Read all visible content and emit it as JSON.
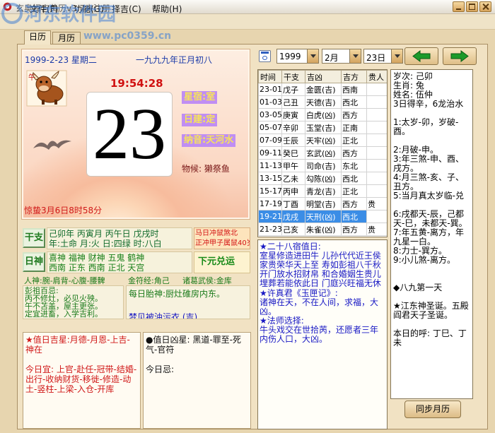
{
  "window": {
    "title": "玄奥择吉黄历v3.7未注册"
  },
  "watermark": {
    "site_name": "河东软件园",
    "url": "www.pc0359.cn"
  },
  "menu": [
    "文件(F)",
    "功能(G)",
    "择吉(C)",
    "帮助(H)"
  ],
  "tabs": [
    {
      "label": "日历",
      "selected": true
    },
    {
      "label": "月历",
      "selected": false
    }
  ],
  "day_view": {
    "date": "1999-2-23 星期二",
    "lunar_date": "一九九九年正月初八",
    "zodiac_label": "午",
    "time": "19:54:28",
    "day": "23",
    "xingxiu": "星宿:室",
    "rijian": "日建:定",
    "nayin": "纳音:天河水",
    "wuhou": "物候: 獭祭鱼",
    "solar_term": "惊蛰3月6日8时58分"
  },
  "ganzhi": {
    "button": "干支",
    "line1": "己卯年 丙寅月 丙午日 戊戌时",
    "line2": "年:土命 月:火 日:四绿 时:八白",
    "chong1": "马日冲鼠煞北",
    "chong2": "正冲甲子属鼠40岁"
  },
  "rishen": {
    "button": "日神",
    "names": "喜神  福神  财神  五鬼  鹤神",
    "directions": "西南  正东  西南  正北  天宫",
    "yun": "下元兑运"
  },
  "misc": {
    "renshen": "人神:腕-肩背-心腹-腰髀",
    "jinfujing": "金符经:角己",
    "zhuge": "诸葛武侯:金库"
  },
  "pengzu": {
    "title": "彭祖百忌:",
    "lines": [
      "丙不修灶，必见火殃。",
      "午不苫盖，屋主更张。",
      "定宜进畜，入学吉利。"
    ]
  },
  "taishen": {
    "text": "每日胎神:厨灶碓房内东。",
    "dream": "梦见被油污衣   (吉)"
  },
  "jixing": {
    "title": "★值日吉星:月德-月恩-上吉-神在",
    "yi_label": "今日宜: ",
    "yi": "上官-赴任-冠带-结婚-出行-收纳财货-移徙-修造-动土-竖柱-上梁-入仓-开库"
  },
  "xiongxing": {
    "title": "●值日凶星: 黑道-罪至-死气-官符",
    "ji_label": "今日忌:",
    "ji": ""
  },
  "toolbar": {
    "year": "1999",
    "month": "2月",
    "day": "23日"
  },
  "hours": {
    "headers": [
      "时间",
      "干支",
      "吉凶",
      "吉方",
      "贵人"
    ],
    "selected_row": 10,
    "rows": [
      {
        "time": "23-01",
        "ganzhi": "戊子",
        "jixiong": "金匮(吉)",
        "direction": "西南",
        "guiren": ""
      },
      {
        "time": "01-03",
        "ganzhi": "己丑",
        "jixiong": "天德(吉)",
        "direction": "西北",
        "guiren": ""
      },
      {
        "time": "03-05",
        "ganzhi": "庚寅",
        "jixiong": "白虎(凶)",
        "direction": "西方",
        "guiren": ""
      },
      {
        "time": "05-07",
        "ganzhi": "辛卯",
        "jixiong": "玉堂(吉)",
        "direction": "正南",
        "guiren": ""
      },
      {
        "time": "07-09",
        "ganzhi": "壬辰",
        "jixiong": "天牢(凶)",
        "direction": "正北",
        "guiren": ""
      },
      {
        "time": "09-11",
        "ganzhi": "癸巳",
        "jixiong": "玄武(凶)",
        "direction": "西方",
        "guiren": ""
      },
      {
        "time": "11-13",
        "ganzhi": "甲午",
        "jixiong": "司命(吉)",
        "direction": "东北",
        "guiren": ""
      },
      {
        "time": "13-15",
        "ganzhi": "乙未",
        "jixiong": "勾陈(凶)",
        "direction": "西北",
        "guiren": ""
      },
      {
        "time": "15-17",
        "ganzhi": "丙申",
        "jixiong": "青龙(吉)",
        "direction": "正北",
        "guiren": ""
      },
      {
        "time": "17-19",
        "ganzhi": "丁酉",
        "jixiong": "明堂(吉)",
        "direction": "西方",
        "guiren": "贵"
      },
      {
        "time": "19-21",
        "ganzhi": "戊戌",
        "jixiong": "天刑(凶)",
        "direction": "西北",
        "guiren": ""
      },
      {
        "time": "21-23",
        "ganzhi": "己亥",
        "jixiong": "朱雀(凶)",
        "direction": "西方",
        "guiren": "贵"
      }
    ]
  },
  "notes": {
    "xiu_title": "★二十八宿值日:",
    "xiu_poem": "室星修造进田牛 儿孙代代近王侯 家贵荣华天上至 寿如彭祖八千秋 开门放水招财帛 和合婚姻生贵儿 埋葬若能依此日 门庭兴旺福无休",
    "yuxia_title": "★许真君《玉匣记》:",
    "yuxia_text": "诸神在天，不在人间，求福，大凶。",
    "fashi_title": "★法师选择:",
    "fashi_text": "牛头戏交在世拾苪，还愿者三年内伤人口，大凶。"
  },
  "info": {
    "year_ganzhi": "岁次: 己卯",
    "zodiac": "生肖: 兔",
    "name": "姓名: 伍仲",
    "dragon": "3日得辛，6龙治水",
    "items": [
      "1:太岁-卯，岁破-酉。",
      "2:月破-申。",
      "3:年三煞-申、酉、戌方。",
      "4:月三煞-亥、子、丑方。",
      "5:当月真太岁临-兑",
      "6:戌都天-辰，己都天-巳，未都天-巽。",
      "7:年五黄-离方，年九星一白。",
      "8:力士-巽方。",
      "9:小儿煞-离方。"
    ],
    "jiu": "◆八九第一天",
    "festival": "★江东神圣诞。五殿阎君天子圣诞。",
    "huchu": "本日的呼: 丁巳、丁未"
  },
  "sync_button": "同步月历",
  "theme": {
    "selected_row": "#3b8de6",
    "lucky_text": "#d01818",
    "notes_text": "#1818c4",
    "panel_bg": "#f1e2c3"
  }
}
